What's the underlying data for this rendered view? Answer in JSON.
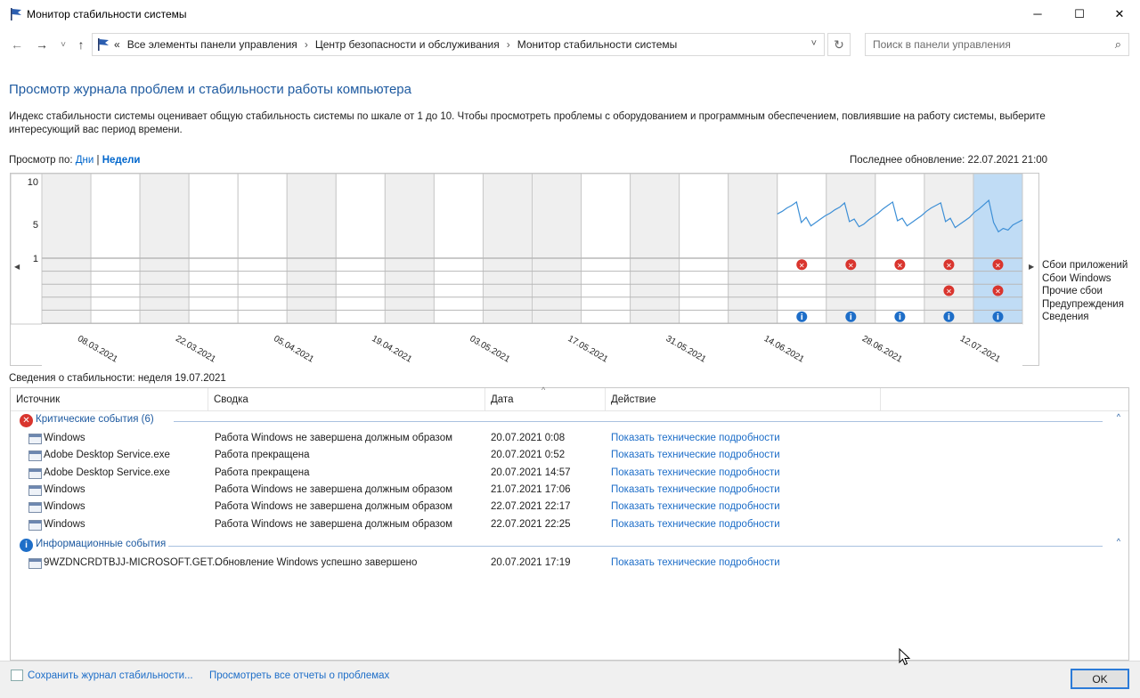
{
  "window": {
    "title": "Монитор стабильности системы",
    "minimize": "─",
    "maximize": "☐",
    "close": "✕"
  },
  "nav": {
    "back": "←",
    "forward": "→",
    "recent": "˅",
    "up": "↑",
    "crumb_overflow": "«",
    "breadcrumbs": [
      "Все элементы панели управления",
      "Центр безопасности и обслуживания",
      "Монитор стабильности системы"
    ],
    "breadcrumb_sep": "›",
    "dropdown": "˅",
    "refresh": "↻",
    "search_placeholder": "Поиск в панели управления",
    "search_icon": "⌕"
  },
  "heading": "Просмотр журнала проблем и стабильности работы компьютера",
  "description": "Индекс стабильности системы оценивает общую стабильность системы по шкале от 1 до 10. Чтобы просмотреть проблемы с оборудованием и программным обеспечением, повлиявшие на работу системы, выберите интересующий вас период времени.",
  "view_by": {
    "label": "Просмотр по:",
    "days": "Дни",
    "sep": "|",
    "weeks": "Недели"
  },
  "last_update": "Последнее обновление: 22.07.2021 21:00",
  "chart_data": {
    "type": "line",
    "yticks": [
      "10",
      "5",
      "1"
    ],
    "ylim": [
      1,
      10
    ],
    "date_labels": [
      "08.03.2021",
      "22.03.2021",
      "05.04.2021",
      "19.04.2021",
      "03.05.2021",
      "17.05.2021",
      "31.05.2021",
      "14.06.2021",
      "28.06.2021",
      "12.07.2021"
    ],
    "columns": 20,
    "data_start_column": 15,
    "selected_column": 19,
    "stability_values": [
      6.2,
      6.5,
      6.9,
      7.2,
      7.6,
      5.2,
      5.8,
      4.8,
      5.2,
      5.6,
      6.0,
      6.3,
      6.7,
      7.0,
      7.5,
      5.3,
      5.6,
      4.7,
      5.0,
      5.5,
      5.9,
      6.3,
      6.8,
      7.2,
      7.6,
      5.4,
      5.7,
      4.8,
      5.2,
      5.6,
      6.0,
      6.5,
      6.9,
      7.2,
      7.5,
      5.3,
      5.7,
      4.6,
      5.0,
      5.4,
      5.8,
      6.4,
      6.8,
      7.3,
      7.8,
      5.2,
      4.1,
      4.5,
      4.3,
      4.9,
      5.2,
      5.5
    ],
    "event_rows": [
      "Сбои приложений",
      "Сбои Windows",
      "Прочие сбои",
      "Предупреждения",
      "Сведения"
    ],
    "app_failures_cols": [
      15,
      16,
      17,
      18,
      19
    ],
    "other_failures_cols": [
      18,
      19
    ],
    "info_cols": [
      15,
      16,
      17,
      18,
      19
    ]
  },
  "nav_arrows": {
    "left": "◀",
    "right": "▶"
  },
  "details_title": "Сведения о стабильности: неделя 19.07.2021",
  "table": {
    "columns": [
      "Источник",
      "Сводка",
      "Дата",
      "Действие"
    ],
    "sort_indicator": "^",
    "collapse": "^",
    "groups": [
      {
        "label": "Критические события (6)",
        "icon": "critical-icon",
        "icon_glyph": "✕",
        "color": "#d9352e",
        "rows": [
          {
            "source": "Windows",
            "summary": "Работа Windows не завершена должным образом",
            "date": "20.07.2021 0:08",
            "action": "Показать технические подробности"
          },
          {
            "source": "Adobe Desktop Service.exe",
            "summary": "Работа прекращена",
            "date": "20.07.2021 0:52",
            "action": "Показать технические подробности"
          },
          {
            "source": "Adobe Desktop Service.exe",
            "summary": "Работа прекращена",
            "date": "20.07.2021 14:57",
            "action": "Показать технические подробности"
          },
          {
            "source": "Windows",
            "summary": "Работа Windows не завершена должным образом",
            "date": "21.07.2021 17:06",
            "action": "Показать технические подробности"
          },
          {
            "source": "Windows",
            "summary": "Работа Windows не завершена должным образом",
            "date": "22.07.2021 22:17",
            "action": "Показать технические подробности"
          },
          {
            "source": "Windows",
            "summary": "Работа Windows не завершена должным образом",
            "date": "22.07.2021 22:25",
            "action": "Показать технические подробности"
          }
        ]
      },
      {
        "label": "Информационные события",
        "icon": "info-icon",
        "icon_glyph": "i",
        "color": "#1e6ec8",
        "rows": [
          {
            "source": "9WZDNCRDTBJJ-MICROSOFT.GET...",
            "summary": "Обновление Windows успешно завершено",
            "date": "20.07.2021 17:19",
            "action": "Показать технические подробности"
          }
        ]
      }
    ]
  },
  "footer": {
    "save_log": "Сохранить журнал стабильности...",
    "view_reports": "Просмотреть все отчеты о проблемах",
    "ok": "OK"
  },
  "colors": {
    "accent_blue": "#1e5aa0",
    "link_blue": "#1e6ec8",
    "error_red": "#d9352e",
    "selected_column": "#c0dcf5",
    "shaded_column": "#efefef",
    "line": "#3d8fd6"
  }
}
